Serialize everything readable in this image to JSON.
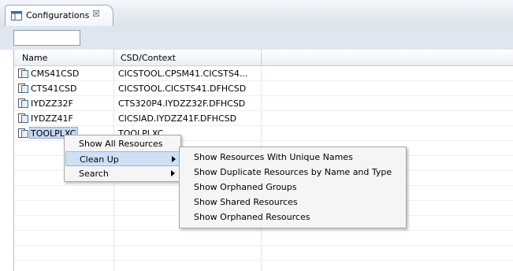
{
  "tab": {
    "label": "Configurations",
    "close": "☒"
  },
  "table": {
    "columns": [
      "Name",
      "CSD/Context"
    ],
    "rows": [
      {
        "name": "CMS41CSD",
        "context": "CICSTOOL.CPSM41.CICSTS4..."
      },
      {
        "name": "CTS41CSD",
        "context": "CICSTOOL.CICSTS41.DFHCSD"
      },
      {
        "name": "IYDZZ32F",
        "context": "CTS320P4.IYDZZ32F.DFHCSD"
      },
      {
        "name": "IYDZZ41F",
        "context": "CICSIAD.IYDZZ41F.DFHCSD"
      },
      {
        "name": "TOOLPLXC",
        "context": "TOOLPLXC"
      }
    ]
  },
  "context_menu": {
    "items": [
      {
        "label": "Show All Resources"
      },
      {
        "label": "Clean Up"
      },
      {
        "label": "Search"
      }
    ]
  },
  "submenu": {
    "items": [
      {
        "label": "Show Resources With Unique Names"
      },
      {
        "label": "Show Duplicate Resources by Name and Type"
      },
      {
        "label": "Show Orphaned Groups"
      },
      {
        "label": "Show Shared Resources"
      },
      {
        "label": "Show Orphaned Resources"
      }
    ]
  },
  "colors": {
    "selection": "#c5d8ee",
    "menu_hover": "#cfe0f5",
    "panel": "#dfe6f0"
  },
  "icons": {
    "tab": "table-view-icon",
    "row": "csd-file-icon"
  }
}
